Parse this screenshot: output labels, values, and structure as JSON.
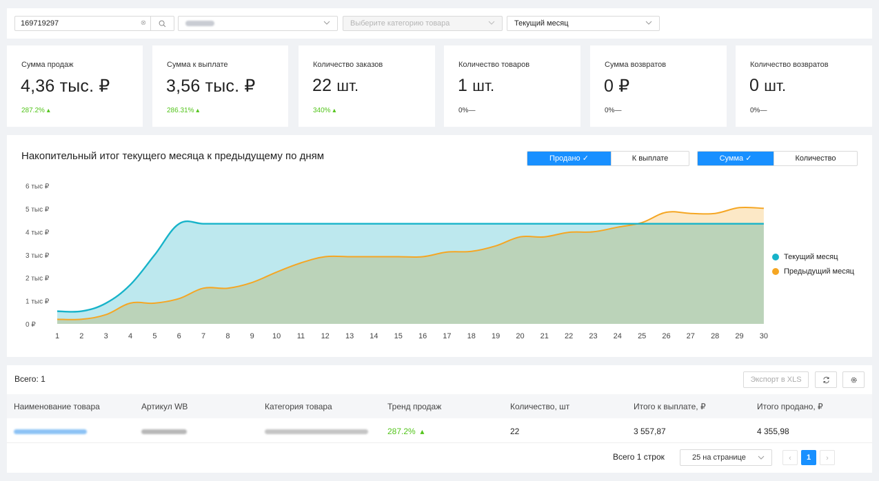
{
  "filters": {
    "search_value": "169719297",
    "category_placeholder": "Выберите категорию товара",
    "period_value": "Текущий месяц"
  },
  "kpis": [
    {
      "label": "Сумма продаж",
      "value": "4,36 тыс. ₽",
      "trend": "287.2%",
      "trend_dir": "up"
    },
    {
      "label": "Сумма к выплате",
      "value": "3,56 тыс. ₽",
      "trend": "286.31%",
      "trend_dir": "up"
    },
    {
      "label": "Количество заказов",
      "value": "22",
      "unit": "шт.",
      "trend": "340%",
      "trend_dir": "up"
    },
    {
      "label": "Количество товаров",
      "value": "1",
      "unit": "шт.",
      "trend": "0%",
      "trend_dir": "flat"
    },
    {
      "label": "Сумма возвратов",
      "value": "0 ₽",
      "trend": "0%",
      "trend_dir": "flat"
    },
    {
      "label": "Количество возвратов",
      "value": "0",
      "unit": "шт.",
      "trend": "0%",
      "trend_dir": "flat"
    }
  ],
  "chart_panel": {
    "title": "Накопительный итог текущего месяца к предыдущему по дням",
    "toggle1": {
      "a": "Продано",
      "b": "К выплате",
      "active": "a"
    },
    "toggle2": {
      "a": "Сумма",
      "b": "Количество",
      "active": "a"
    }
  },
  "chart_data": {
    "type": "area",
    "title": "Накопительный итог текущего месяца к предыдущему по дням",
    "x": [
      1,
      2,
      3,
      4,
      5,
      6,
      7,
      8,
      9,
      10,
      11,
      12,
      13,
      14,
      15,
      16,
      17,
      18,
      19,
      20,
      21,
      22,
      23,
      24,
      25,
      26,
      27,
      28,
      29,
      30
    ],
    "y_ticks": [
      "0 ₽",
      "1 тыс ₽",
      "2 тыс ₽",
      "3 тыс ₽",
      "4 тыс ₽",
      "5 тыс ₽",
      "6 тыс ₽"
    ],
    "ylim": [
      0,
      6000
    ],
    "legend_position": "right",
    "series": [
      {
        "name": "Текущий месяц",
        "color": "#17b3c9",
        "fill": "#bde8ee",
        "values": [
          550,
          550,
          900,
          1700,
          3000,
          4350,
          4350,
          4350,
          4350,
          4350,
          4350,
          4350,
          4350,
          4350,
          4350,
          4350,
          4350,
          4350,
          4350,
          4350,
          4350,
          4350,
          4350,
          4350,
          4350,
          4350,
          4350,
          4350,
          4350,
          4350
        ]
      },
      {
        "name": "Предыдущий месяц",
        "color": "#f5a623",
        "fill": "#fce8c6",
        "values": [
          200,
          200,
          400,
          900,
          900,
          1100,
          1550,
          1550,
          1800,
          2250,
          2650,
          2920,
          2920,
          2920,
          2920,
          2920,
          3120,
          3150,
          3390,
          3780,
          3780,
          3980,
          4000,
          4200,
          4400,
          4850,
          4800,
          4800,
          5050,
          5020
        ]
      }
    ]
  },
  "table": {
    "total_label": "Всего: 1",
    "export_label": "Экспорт в XLS",
    "columns": [
      "Наименование товара",
      "Артикул WB",
      "Категория товара",
      "Тренд продаж",
      "Количество, шт",
      "Итого к выплате, ₽",
      "Итого продано, ₽"
    ],
    "rows": [
      {
        "trend": "287.2%",
        "qty": "22",
        "payout": "3 557,87",
        "sold": "4 355,98"
      }
    ],
    "pager": {
      "total": "Всего 1 строк",
      "page_size": "25 на странице",
      "current_page": "1"
    }
  },
  "colors": {
    "accent": "#1890ff",
    "up": "#52c41a"
  }
}
